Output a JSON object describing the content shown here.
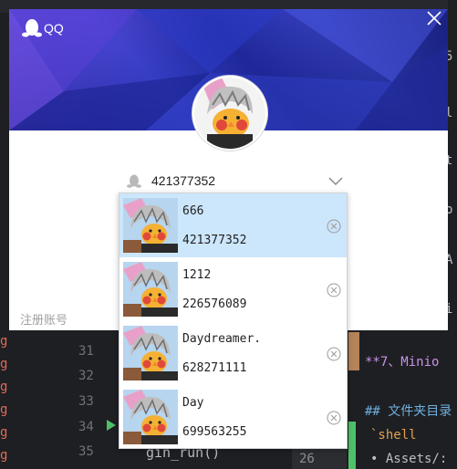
{
  "ide": {
    "left_letters": [
      "g",
      "g",
      "g",
      "g",
      "g",
      "g"
    ],
    "line_numbers": [
      "31",
      "32",
      "33",
      "34",
      "35"
    ],
    "bottom_code": "gin_run()",
    "right_lines": [
      {
        "text": "**7、Minio",
        "color": "#c792ea"
      },
      {
        "text": "## 文件夹目录",
        "color": "#6fb0e0"
      },
      {
        "text": "`shell",
        "color": "#e0a050"
      },
      {
        "text": "• Assets/:",
        "color": "#bcbec4"
      }
    ],
    "gutter_number": "26",
    "right_edge_chars": [
      "5",
      "l",
      "t",
      "p",
      "A",
      "i"
    ]
  },
  "qq_window": {
    "logo_text": "QQ",
    "account_value": "421377352",
    "register_label": "注册账号",
    "accounts": [
      {
        "name": "666",
        "number": "421377352",
        "selected": true
      },
      {
        "name": "1212",
        "number": "226576089",
        "selected": false
      },
      {
        "name": "Daydreamer.",
        "number": "628271111",
        "selected": false
      },
      {
        "name": "Day",
        "number": "699563255",
        "selected": false
      }
    ]
  },
  "colors": {
    "banner_blue": "#2a36b8",
    "selected_row": "#cce6fb",
    "green_marker": "#4fc16a",
    "orange_marker": "#b5835a"
  }
}
